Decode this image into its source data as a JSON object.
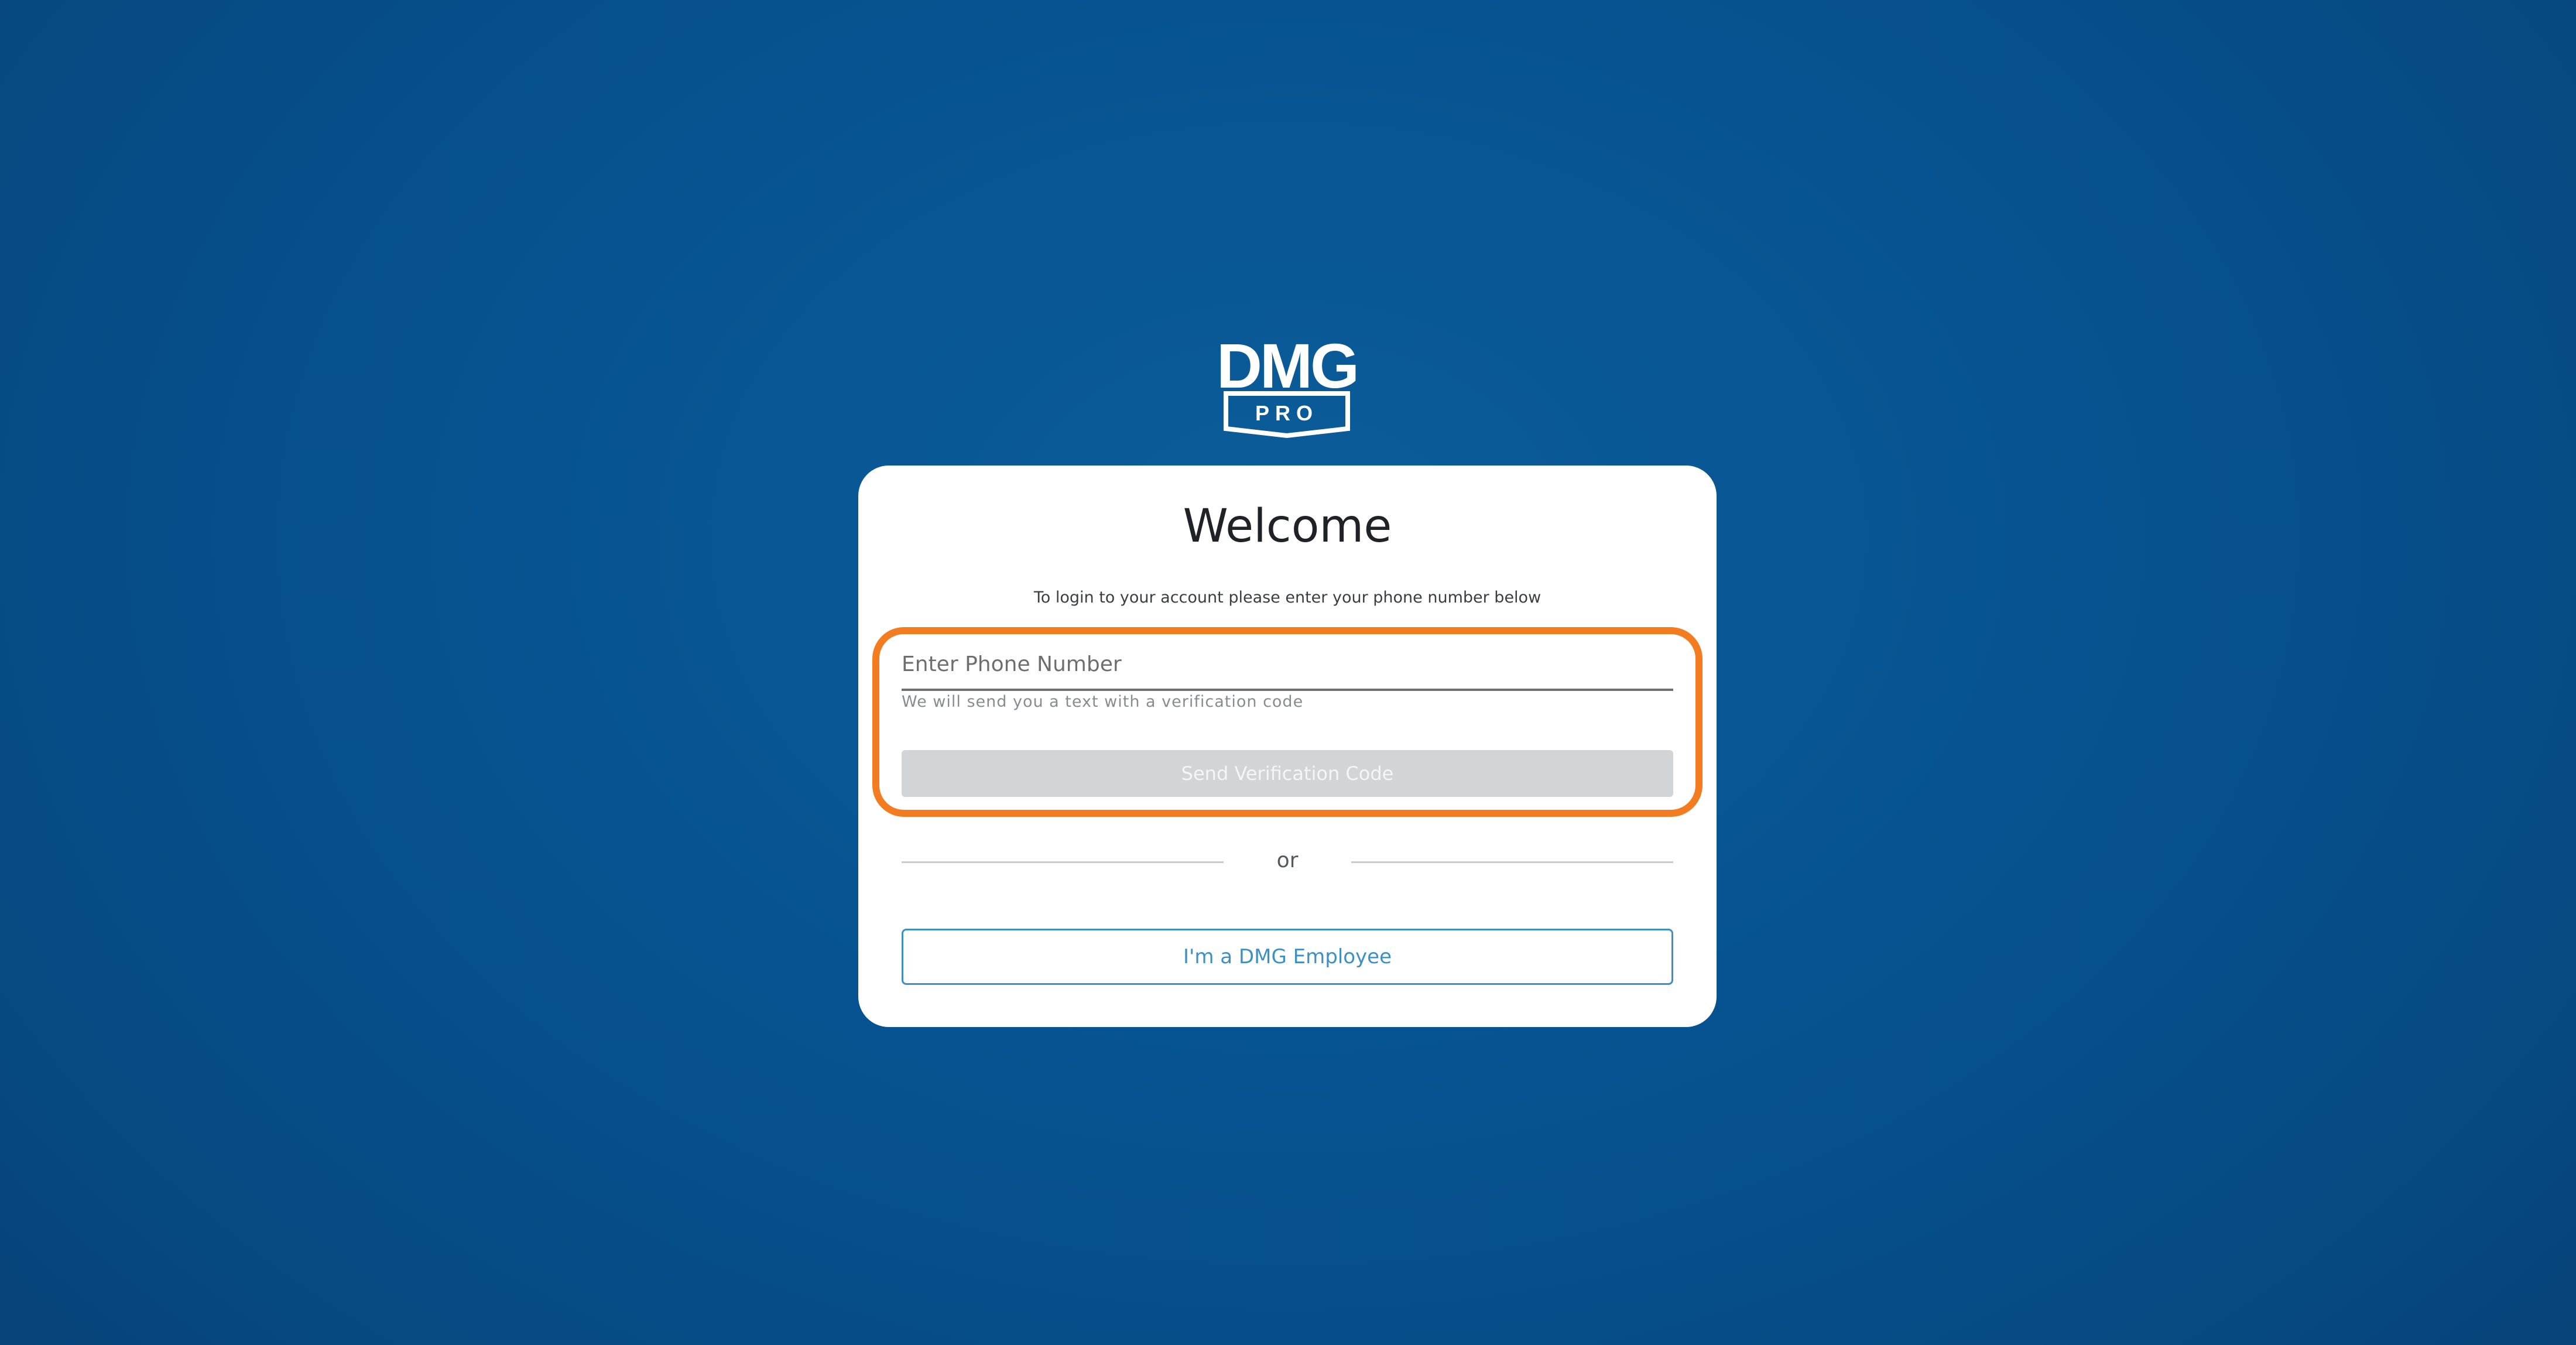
{
  "brand": {
    "logo_icon": "dmg-pro-logo",
    "logo_text": "DMG",
    "logo_subtext": "PRO"
  },
  "login": {
    "title": "Welcome",
    "subtitle": "To login to your account please enter your phone number below",
    "phone_placeholder": "Enter Phone Number",
    "phone_value": "",
    "helper_text": "We will send you a text with a verification code",
    "send_button_label": "Send Verification Code",
    "divider_text": "or",
    "employee_button_label": "I'm a DMG Employee"
  },
  "colors": {
    "background": "#075391",
    "highlight": "#f47c20",
    "accent": "#3d8fc4",
    "disabled_button": "#d2d5d8"
  }
}
